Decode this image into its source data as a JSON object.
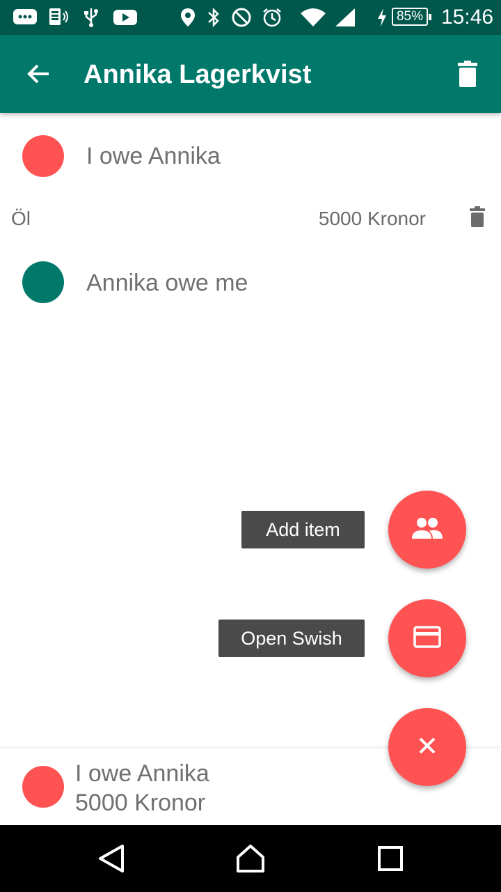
{
  "status_bar": {
    "battery": "85%",
    "time": "15:46",
    "icons": [
      "messages-icon",
      "sim-card-icon",
      "usb-icon",
      "youtube-icon",
      "location-icon",
      "bluetooth-icon",
      "do-not-disturb-icon",
      "alarm-icon",
      "wifi-icon",
      "signal-icon",
      "charging-icon",
      "battery-icon"
    ]
  },
  "app_bar": {
    "title": "Annika Lagerkvist",
    "background": "#00796B",
    "status_background": "#00574B"
  },
  "sections": {
    "i_owe": {
      "label": "I owe Annika",
      "color": "#FF5252"
    },
    "they_owe": {
      "label": "Annika owe me",
      "color": "#00796B"
    }
  },
  "items": [
    {
      "name": "Öl",
      "amount": "5000",
      "unit": "Kronor"
    }
  ],
  "fab_menu": {
    "add_item_label": "Add item",
    "open_swish_label": "Open Swish",
    "color": "#FF5252"
  },
  "summary": {
    "line1": "I owe Annika",
    "line2": "5000 Kronor"
  }
}
